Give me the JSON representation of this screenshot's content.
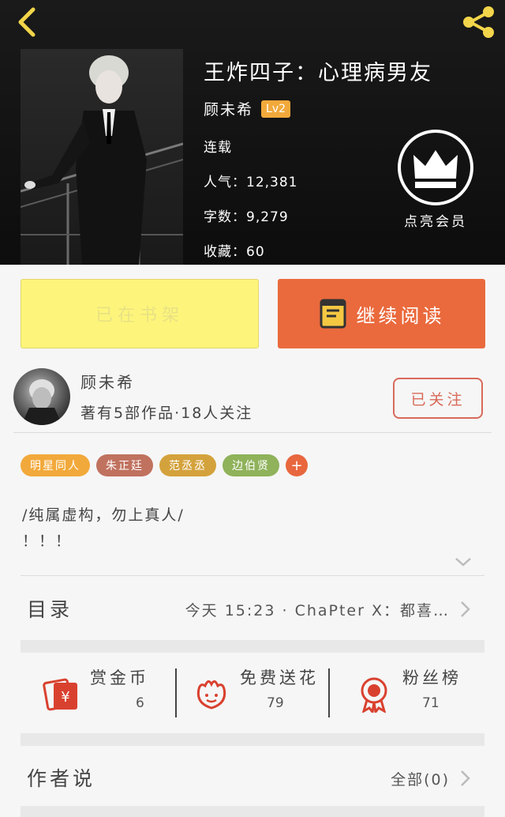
{
  "book": {
    "title": "王炸四子：心理病男友",
    "author": "顾未希",
    "level": "Lv2",
    "status": "连载",
    "popularity": "人气：12,381",
    "word_count": "字数：9,279",
    "favorites": "收藏：60"
  },
  "vip": {
    "label": "点亮会员"
  },
  "actions": {
    "shelf_label": "已在书架",
    "read_label": "继续阅读"
  },
  "author_card": {
    "name": "顾未希",
    "stats": "著有5部作品·18人关注",
    "follow_label": "已关注"
  },
  "tags": [
    {
      "label": "明星同人",
      "color": "#f2a93b"
    },
    {
      "label": "朱正廷",
      "color": "#c0725f"
    },
    {
      "label": "范丞丞",
      "color": "#d4a23c"
    },
    {
      "label": "边伯贤",
      "color": "#8fb25a"
    }
  ],
  "tag_add": "+",
  "description": {
    "line1": "/纯属虚构，勿上真人/",
    "line2": "！！！"
  },
  "catalog": {
    "label": "目录",
    "update": "今天 15:23 · ChaPter X：都喜…"
  },
  "stats": {
    "reward": {
      "label": "赏金币",
      "value": "6"
    },
    "flowers": {
      "label": "免费送花",
      "value": "79"
    },
    "fans": {
      "label": "粉丝榜",
      "value": "71"
    }
  },
  "author_says": {
    "label": "作者说",
    "all": "全部(0)"
  },
  "colors": {
    "accent_orange": "#ea6a3d",
    "shelf_yellow": "#fdf57b",
    "follow_red": "#d86a5a",
    "icon_red": "#d9412f"
  }
}
